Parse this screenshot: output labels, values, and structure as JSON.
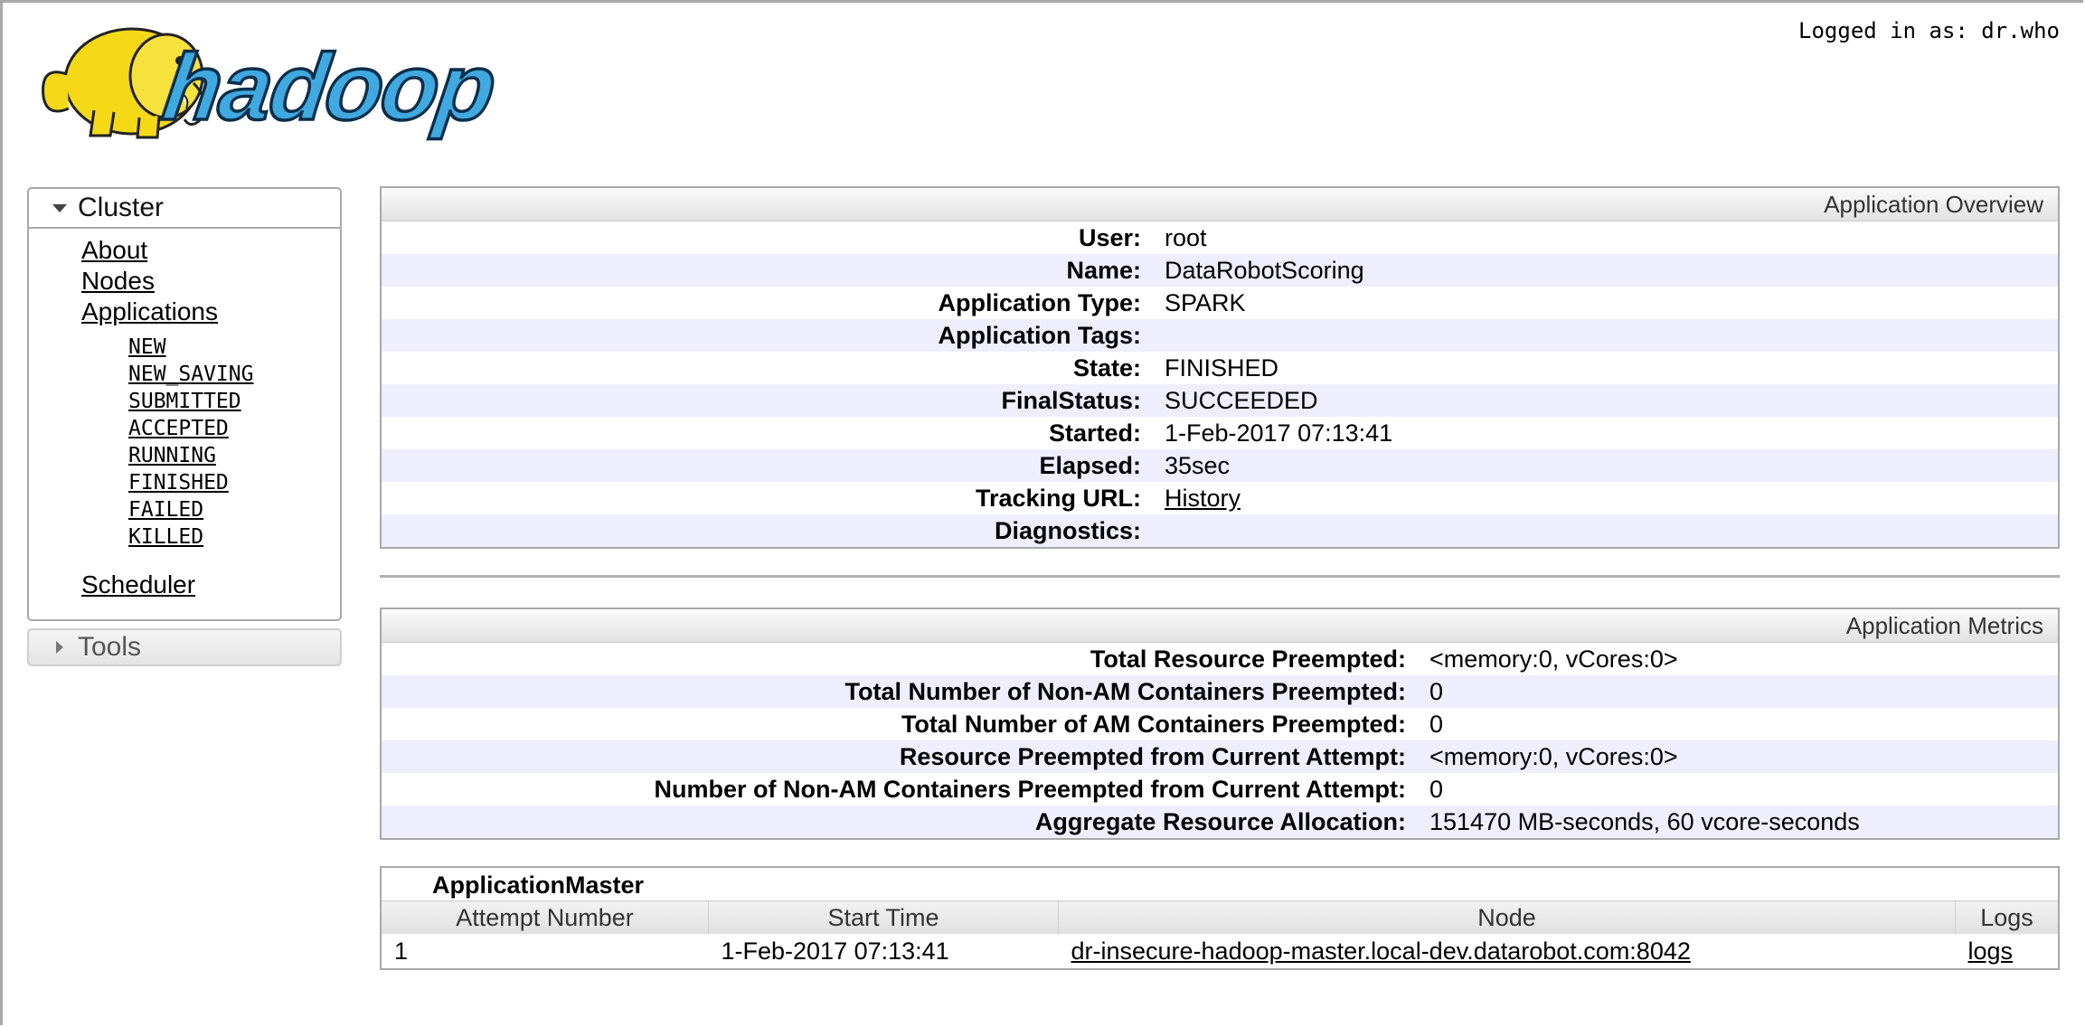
{
  "header": {
    "login_text": "Logged in as: dr.who",
    "logo_text": "hadoop"
  },
  "sidebar": {
    "cluster_label": "Cluster",
    "links": [
      "About",
      "Nodes",
      "Applications"
    ],
    "app_states": [
      "NEW",
      "NEW_SAVING",
      "SUBMITTED",
      "ACCEPTED",
      "RUNNING",
      "FINISHED",
      "FAILED",
      "KILLED"
    ],
    "scheduler_label": "Scheduler",
    "tools_label": "Tools"
  },
  "overview": {
    "title": "Application Overview",
    "rows": [
      {
        "label": "User:",
        "value": "root"
      },
      {
        "label": "Name:",
        "value": "DataRobotScoring"
      },
      {
        "label": "Application Type:",
        "value": "SPARK"
      },
      {
        "label": "Application Tags:",
        "value": ""
      },
      {
        "label": "State:",
        "value": "FINISHED"
      },
      {
        "label": "FinalStatus:",
        "value": "SUCCEEDED"
      },
      {
        "label": "Started:",
        "value": "1-Feb-2017 07:13:41"
      },
      {
        "label": "Elapsed:",
        "value": "35sec"
      },
      {
        "label": "Tracking URL:",
        "value": "History"
      },
      {
        "label": "Diagnostics:",
        "value": ""
      }
    ]
  },
  "metrics": {
    "title": "Application Metrics",
    "rows": [
      {
        "label": "Total Resource Preempted:",
        "value": "<memory:0, vCores:0>"
      },
      {
        "label": "Total Number of Non-AM Containers Preempted:",
        "value": "0"
      },
      {
        "label": "Total Number of AM Containers Preempted:",
        "value": "0"
      },
      {
        "label": "Resource Preempted from Current Attempt:",
        "value": "<memory:0, vCores:0>"
      },
      {
        "label": "Number of Non-AM Containers Preempted from Current Attempt:",
        "value": "0"
      },
      {
        "label": "Aggregate Resource Allocation:",
        "value": "151470 MB-seconds, 60 vcore-seconds"
      }
    ]
  },
  "app_master": {
    "title": "ApplicationMaster",
    "columns": [
      "Attempt Number",
      "Start Time",
      "Node",
      "Logs"
    ],
    "rows": [
      {
        "attempt": "1",
        "start_time": "1-Feb-2017 07:13:41",
        "node": "dr-insecure-hadoop-master.local-dev.datarobot.com:8042",
        "logs": "logs"
      }
    ]
  },
  "colors": {
    "logo_blue": "#3fa9e0",
    "elephant_yellow": "#f5d916",
    "row_alt": "#eeeeff",
    "border_gray": "#a9a9a9"
  }
}
